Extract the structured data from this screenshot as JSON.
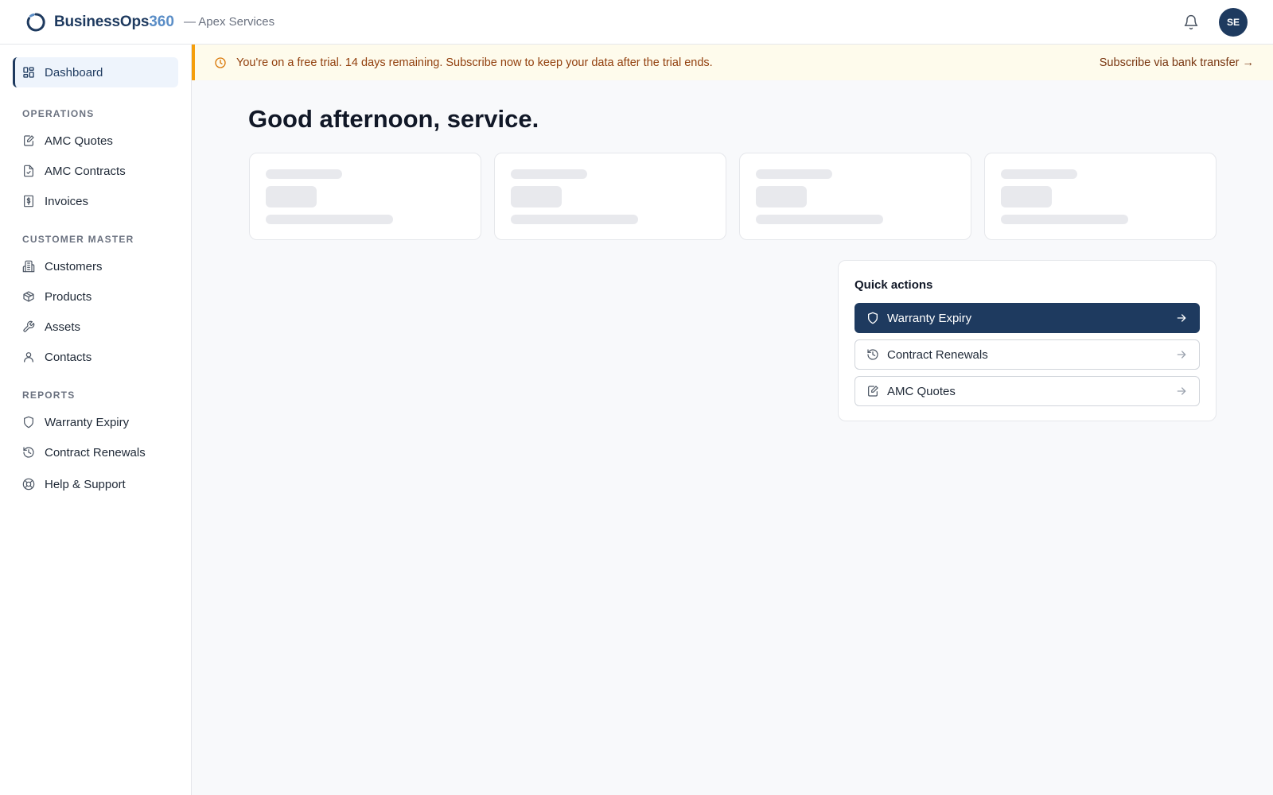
{
  "header": {
    "brand_name": "BusinessOps",
    "brand_number": "360",
    "org": "— Apex Services",
    "avatar_initials": "SE",
    "logo_icon": "brand-ring-icon",
    "notifications_icon": "bell-icon"
  },
  "sidebar": {
    "dashboard": "Dashboard",
    "sections": {
      "operations": "OPERATIONS",
      "customer_master": "CUSTOMER MASTER",
      "reports": "REPORTS"
    },
    "operations": [
      "AMC Quotes",
      "AMC Contracts",
      "Invoices"
    ],
    "customer_master": [
      "Customers",
      "Products",
      "Assets",
      "Contacts"
    ],
    "reports": [
      "Warranty Expiry",
      "Contract Renewals"
    ],
    "help": "Help & Support"
  },
  "banner": {
    "text": "You're on a free trial. 14 days remaining. Subscribe now to keep your data after the trial ends.",
    "link": "Subscribe via bank transfer →"
  },
  "main": {
    "greeting": "Good afternoon, service.",
    "stat_cards_loading": 4,
    "quick_actions": {
      "title": "Quick actions",
      "items": [
        "Warranty Expiry",
        "Contract Renewals",
        "AMC Quotes"
      ]
    }
  },
  "colors": {
    "brand": "#1e3a5f",
    "brand_accent": "#5b8ec7",
    "banner_bg": "#fefbec",
    "banner_accent": "#f59e0b"
  }
}
